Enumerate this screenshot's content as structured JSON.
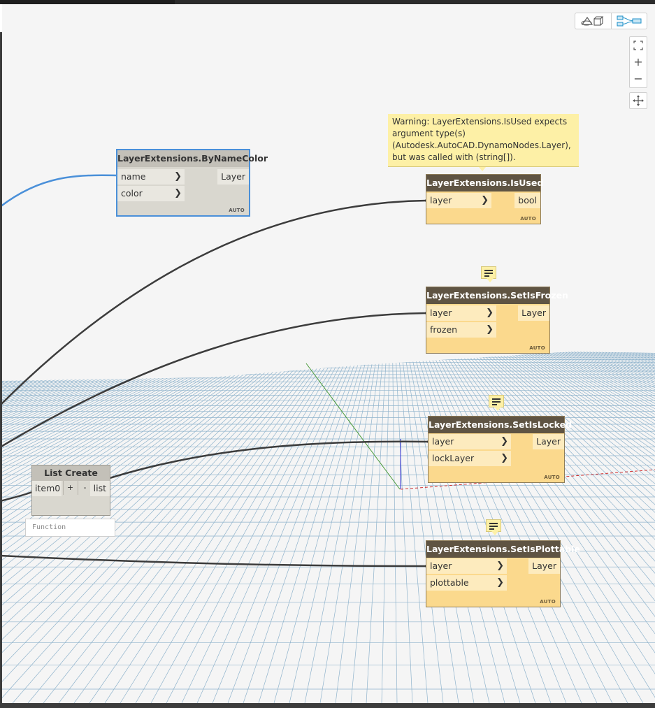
{
  "viewport": {
    "view_toggle": {
      "geometry_icon": "3d-geometry-view-icon",
      "graph_icon": "graph-view-icon",
      "active": "graph"
    },
    "zoom": {
      "fit_icon": "fit-to-screen-icon",
      "zoom_in_label": "+",
      "zoom_out_label": "−"
    },
    "pan_icon": "pan-icon"
  },
  "nodes": {
    "by_name_color": {
      "title": "LayerExtensions.ByNameColor",
      "inputs": [
        "name",
        "color"
      ],
      "output": "Layer",
      "auto": "AUTO",
      "selected": true
    },
    "is_used": {
      "title": "LayerExtensions.IsUsed",
      "inputs": [
        "layer"
      ],
      "output": "bool",
      "auto": "AUTO",
      "warning": "Warning: LayerExtensions.IsUsed expects argument type(s) (Autodesk.AutoCAD.DynamoNodes.Layer), but was called with (string[])."
    },
    "set_is_frozen": {
      "title": "LayerExtensions.SetIsFrozen",
      "inputs": [
        "layer",
        "frozen"
      ],
      "output": "Layer",
      "auto": "AUTO"
    },
    "set_is_locked": {
      "title": "LayerExtensions.SetIsLocked",
      "inputs": [
        "layer",
        "lockLayer"
      ],
      "output": "Layer",
      "auto": "AUTO"
    },
    "set_is_plottable": {
      "title": "LayerExtensions.SetIsPlottable",
      "inputs": [
        "layer",
        "plottable"
      ],
      "output": "Layer",
      "auto": "AUTO"
    },
    "list_create": {
      "title": "List Create",
      "input": "item0",
      "add_label": "+",
      "remove_label": "-",
      "output": "list",
      "function_placeholder": "Function"
    }
  },
  "colors": {
    "node_header": "#5f5443",
    "node_body": "#fbd98d",
    "node_port": "#fdebbe",
    "selection": "#4a90d9",
    "wire": "#3c3c3c",
    "warning_bg": "#fdf0a6",
    "grid": "#8fb3cc"
  }
}
